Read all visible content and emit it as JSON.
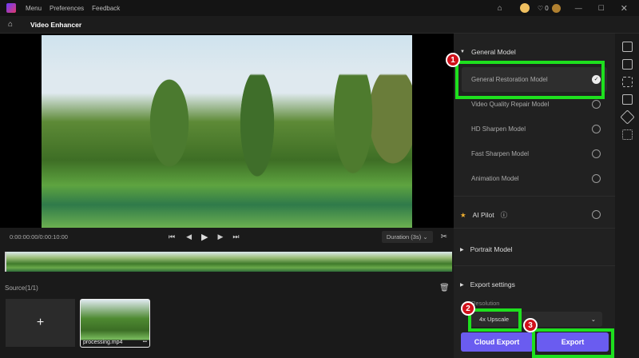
{
  "titlebar": {
    "menu": "Menu",
    "preferences": "Preferences",
    "feedback": "Feedback",
    "credits": "0"
  },
  "subbar": {
    "title": "Video Enhancer"
  },
  "controls": {
    "time": "0:00:00:00/0:00:10:00",
    "duration": "Duration (3s)"
  },
  "source": {
    "label": "Source(1/1)",
    "file": "processing.mp4",
    "add": "+",
    "more": "•••"
  },
  "panel": {
    "general_model": "General Model",
    "models": [
      {
        "label": "General Restoration Model",
        "selected": true
      },
      {
        "label": "Video Quality Repair Model",
        "selected": false
      },
      {
        "label": "HD Sharpen Model",
        "selected": false
      },
      {
        "label": "Fast Sharpen Model",
        "selected": false
      },
      {
        "label": "Animation Model",
        "selected": false
      }
    ],
    "ai_pilot": "AI Pilot",
    "portrait_model": "Portrait Model",
    "export_settings": "Export settings",
    "resolution_label": "Resolution",
    "resolution_value": "4x Upscale",
    "cloud_export": "Cloud Export",
    "export": "Export"
  },
  "annotations": [
    "1",
    "2",
    "3"
  ],
  "colors": {
    "accent": "#6a5cf0",
    "highlight": "#1ee01e",
    "badge": "#d0101a"
  }
}
